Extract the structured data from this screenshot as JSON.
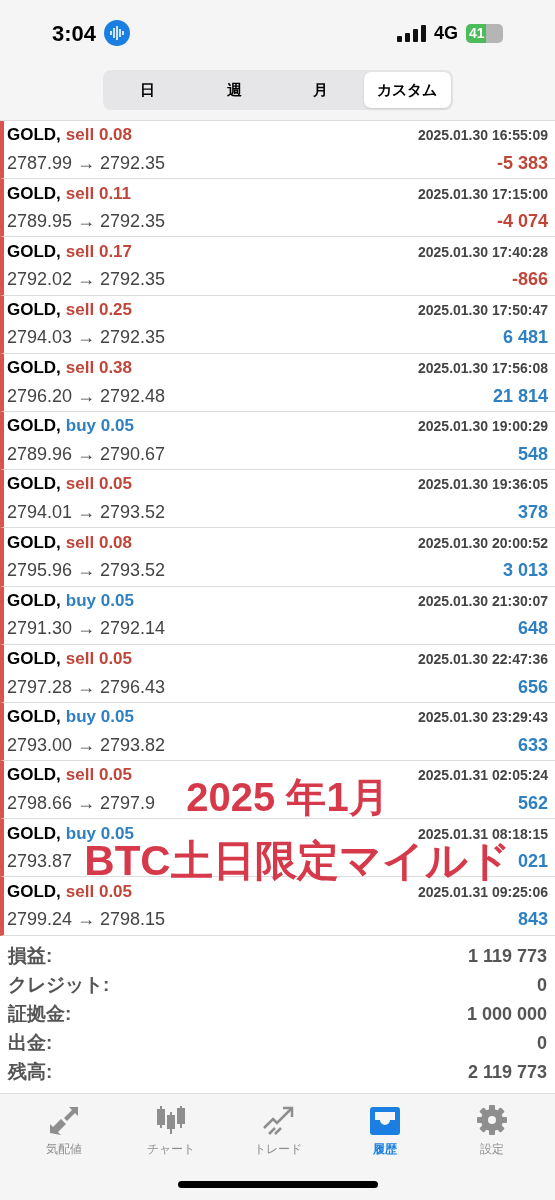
{
  "status_bar": {
    "time": "3:04",
    "network": "4G",
    "battery": "41"
  },
  "period_tabs": [
    {
      "label": "日",
      "selected": false
    },
    {
      "label": "週",
      "selected": false
    },
    {
      "label": "月",
      "selected": false
    },
    {
      "label": "カスタム",
      "selected": true
    }
  ],
  "trades": [
    {
      "symbol": "GOLD,",
      "kind": "sell",
      "order": "sell 0.08",
      "time": "2025.01.30 16:55:09",
      "prices": "2787.99 → 2792.35",
      "profit": "-5 383",
      "loss": true
    },
    {
      "symbol": "GOLD,",
      "kind": "sell",
      "order": "sell 0.11",
      "time": "2025.01.30 17:15:00",
      "prices": "2789.95 → 2792.35",
      "profit": "-4 074",
      "loss": true
    },
    {
      "symbol": "GOLD,",
      "kind": "sell",
      "order": "sell 0.17",
      "time": "2025.01.30 17:40:28",
      "prices": "2792.02 → 2792.35",
      "profit": "-866",
      "loss": true
    },
    {
      "symbol": "GOLD,",
      "kind": "sell",
      "order": "sell 0.25",
      "time": "2025.01.30 17:50:47",
      "prices": "2794.03 → 2792.35",
      "profit": "6 481",
      "loss": false
    },
    {
      "symbol": "GOLD,",
      "kind": "sell",
      "order": "sell 0.38",
      "time": "2025.01.30 17:56:08",
      "prices": "2796.20 → 2792.48",
      "profit": "21 814",
      "loss": false
    },
    {
      "symbol": "GOLD,",
      "kind": "buy",
      "order": "buy 0.05",
      "time": "2025.01.30 19:00:29",
      "prices": "2789.96 → 2790.67",
      "profit": "548",
      "loss": false
    },
    {
      "symbol": "GOLD,",
      "kind": "sell",
      "order": "sell 0.05",
      "time": "2025.01.30 19:36:05",
      "prices": "2794.01 → 2793.52",
      "profit": "378",
      "loss": false
    },
    {
      "symbol": "GOLD,",
      "kind": "sell",
      "order": "sell 0.08",
      "time": "2025.01.30 20:00:52",
      "prices": "2795.96 → 2793.52",
      "profit": "3 013",
      "loss": false
    },
    {
      "symbol": "GOLD,",
      "kind": "buy",
      "order": "buy 0.05",
      "time": "2025.01.30 21:30:07",
      "prices": "2791.30 → 2792.14",
      "profit": "648",
      "loss": false
    },
    {
      "symbol": "GOLD,",
      "kind": "sell",
      "order": "sell 0.05",
      "time": "2025.01.30 22:47:36",
      "prices": "2797.28 → 2796.43",
      "profit": "656",
      "loss": false
    },
    {
      "symbol": "GOLD,",
      "kind": "buy",
      "order": "buy 0.05",
      "time": "2025.01.30 23:29:43",
      "prices": "2793.00 → 2793.82",
      "profit": "633",
      "loss": false
    },
    {
      "symbol": "GOLD,",
      "kind": "sell",
      "order": "sell 0.05",
      "time": "2025.01.31 02:05:24",
      "prices": "2798.66 → 2797.9",
      "profit": "562",
      "loss": false
    },
    {
      "symbol": "GOLD,",
      "kind": "buy",
      "order": "buy 0.05",
      "time": "2025.01.31 08:18:15",
      "prices": "2793.87",
      "profit": "021",
      "loss": false
    },
    {
      "symbol": "GOLD,",
      "kind": "sell",
      "order": "sell 0.05",
      "time": "2025.01.31 09:25:06",
      "prices": "2799.24 → 2798.15",
      "profit": "843",
      "loss": false
    }
  ],
  "summary": [
    {
      "label": "損益:",
      "value": "1 119 773"
    },
    {
      "label": "クレジット:",
      "value": "0"
    },
    {
      "label": "証拠金:",
      "value": "1 000 000"
    },
    {
      "label": "出金:",
      "value": "0"
    },
    {
      "label": "残高:",
      "value": "2 119 773"
    }
  ],
  "overlay": [
    "2025 年1月",
    "BTC土日限定マイルド"
  ],
  "tab_bar": [
    {
      "kind": "quotes",
      "label": "気配値",
      "selected": false
    },
    {
      "kind": "chart",
      "label": "チャート",
      "selected": false
    },
    {
      "kind": "trade",
      "label": "トレード",
      "selected": false
    },
    {
      "kind": "history",
      "label": "履歴",
      "selected": true
    },
    {
      "kind": "settings",
      "label": "設定",
      "selected": false
    }
  ]
}
